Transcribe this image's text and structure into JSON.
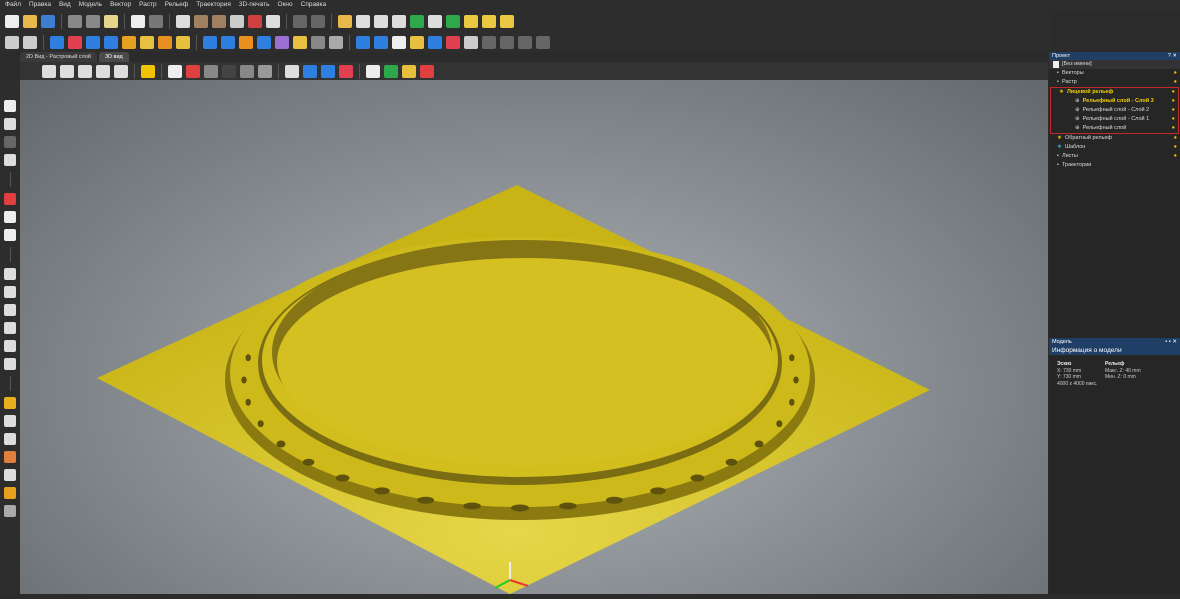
{
  "menu": [
    "Файл",
    "Правка",
    "Вид",
    "Модель",
    "Вектор",
    "Растр",
    "Рельеф",
    "Траектория",
    "3D-печать",
    "Окно",
    "Справка"
  ],
  "toolbar1": [
    {
      "icon": "new-file-icon",
      "color": "#eeeeee"
    },
    {
      "icon": "open-folder-icon",
      "color": "#e8b84a"
    },
    {
      "icon": "save-icon",
      "color": "#3c7fd0"
    },
    {
      "icon": "cut-icon",
      "color": "#888888"
    },
    {
      "icon": "copy-icon",
      "color": "#888888"
    },
    {
      "icon": "paste-icon",
      "color": "#e6d48a"
    },
    {
      "icon": "undo-icon",
      "color": "#eeeeee"
    },
    {
      "icon": "redo-icon",
      "color": "#777777"
    },
    {
      "icon": "document-icon",
      "color": "#dddddd"
    },
    {
      "icon": "model-size-icon",
      "color": "#a08060"
    },
    {
      "icon": "split-icon",
      "color": "#a08060"
    },
    {
      "icon": "grid-icon",
      "color": "#cccccc"
    },
    {
      "icon": "pin-icon",
      "color": "#d04040"
    },
    {
      "icon": "scale-icon",
      "color": "#dddddd"
    },
    {
      "icon": "shape-icon",
      "color": "#666666"
    },
    {
      "icon": "move-icon",
      "color": "#666666"
    },
    {
      "icon": "vector-import-icon",
      "color": "#e8b84a"
    },
    {
      "icon": "vector-draw-icon",
      "color": "#dddddd"
    },
    {
      "icon": "node-icon",
      "color": "#dddddd"
    },
    {
      "icon": "snowflake-icon",
      "color": "#dddddd"
    },
    {
      "icon": "relief-import-icon",
      "color": "#2ea84a"
    },
    {
      "icon": "image-icon",
      "color": "#dddddd"
    },
    {
      "icon": "layer-green-icon",
      "color": "#2ea84a"
    },
    {
      "icon": "network-icon",
      "color": "#e8c840"
    },
    {
      "icon": "wave-icon",
      "color": "#e8c840"
    },
    {
      "icon": "curve-icon",
      "color": "#e8c840"
    }
  ],
  "toolbar2": [
    {
      "icon": "zoom-icon",
      "color": "#cccccc"
    },
    {
      "icon": "settings-icon",
      "color": "#cccccc"
    },
    {
      "icon": "relief-blue-icon",
      "color": "#2f7fe0"
    },
    {
      "icon": "eraser-icon",
      "color": "#e04050"
    },
    {
      "icon": "relief-cone-icon",
      "color": "#2f7fe0"
    },
    {
      "icon": "relief-multi-icon",
      "color": "#2f7fe0"
    },
    {
      "icon": "texture-icon",
      "color": "#e8a020"
    },
    {
      "icon": "relief-bake-icon",
      "color": "#e8c040"
    },
    {
      "icon": "relief-orange-icon",
      "color": "#e89020"
    },
    {
      "icon": "relief-star-icon",
      "color": "#e8c040"
    },
    {
      "icon": "relief-flat-icon",
      "color": "#2f7fe0"
    },
    {
      "icon": "relief-sharp-icon",
      "color": "#2f7fe0"
    },
    {
      "icon": "relief-plane-icon",
      "color": "#e89020"
    },
    {
      "icon": "relief-add-icon",
      "color": "#2f7fe0"
    },
    {
      "icon": "relief-layer-icon",
      "color": "#9a70d0"
    },
    {
      "icon": "relief-smooth-icon",
      "color": "#e8c040"
    },
    {
      "icon": "relief-gray-icon",
      "color": "#888888"
    },
    {
      "icon": "arrows-icon",
      "color": "#aaaaaa"
    },
    {
      "icon": "relief-scale-icon",
      "color": "#2f7fe0"
    },
    {
      "icon": "relief-offset-icon",
      "color": "#2f7fe0"
    },
    {
      "icon": "relief-white-icon",
      "color": "#eeeeee"
    },
    {
      "icon": "layers-icon",
      "color": "#e8c040"
    },
    {
      "icon": "relief-pin-icon",
      "color": "#2f7fe0"
    },
    {
      "icon": "sphere-icon",
      "color": "#e04050"
    },
    {
      "icon": "magnet-icon",
      "color": "#cccccc"
    },
    {
      "icon": "rect-icon",
      "color": "#666666"
    },
    {
      "icon": "curve2-icon",
      "color": "#666666"
    },
    {
      "icon": "shape2-icon",
      "color": "#666666"
    },
    {
      "icon": "frame-icon",
      "color": "#666666"
    }
  ],
  "tabs": [
    "2D Вид - Растровый слой",
    "3D вид"
  ],
  "toolbar3": [
    {
      "icon": "cube-iso-icon",
      "color": "#dddddd"
    },
    {
      "icon": "cube-front-icon",
      "color": "#dddddd"
    },
    {
      "icon": "cube-side-icon",
      "color": "#dddddd"
    },
    {
      "icon": "cube-top-icon",
      "color": "#dddddd"
    },
    {
      "icon": "zoom-fit-icon",
      "color": "#dddddd"
    },
    {
      "icon": "light-icon",
      "color": "#f2c400"
    },
    {
      "icon": "plane-view-icon",
      "color": "#eeeeee"
    },
    {
      "icon": "axes-icon",
      "color": "#e04040"
    },
    {
      "icon": "grid-view-icon",
      "color": "#888888"
    },
    {
      "icon": "pointer-icon",
      "color": "#444444"
    },
    {
      "icon": "ruler-icon",
      "color": "#888888"
    },
    {
      "icon": "box-icon",
      "color": "#999999"
    },
    {
      "icon": "wire-icon",
      "color": "#dddddd"
    },
    {
      "icon": "relief-view-icon",
      "color": "#2f7fe0"
    },
    {
      "icon": "layer-view-icon",
      "color": "#2f7fe0"
    },
    {
      "icon": "red-view-icon",
      "color": "#e04050"
    },
    {
      "icon": "shade-icon",
      "color": "#eeeeee"
    },
    {
      "icon": "color-icon",
      "color": "#2ea84a"
    },
    {
      "icon": "material-icon",
      "color": "#e8c040"
    },
    {
      "icon": "palette-icon",
      "color": "#e04040"
    }
  ],
  "lefttools": [
    {
      "icon": "select-arrow-icon",
      "color": "#eeeeee"
    },
    {
      "icon": "node-edit-icon",
      "color": "#dddddd"
    },
    {
      "icon": "transform-icon",
      "color": "#666666"
    },
    {
      "icon": "grid-tool-icon",
      "color": "#dddddd"
    },
    {
      "icon": "pen-icon",
      "color": "#e04040"
    },
    {
      "icon": "eraser-tool-icon",
      "color": "#eeeeee"
    },
    {
      "icon": "fill-icon",
      "color": "#eeeeee"
    },
    {
      "icon": "polyline-icon",
      "color": "#dddddd"
    },
    {
      "icon": "rectangle-icon",
      "color": "#dddddd"
    },
    {
      "icon": "circle-icon",
      "color": "#dddddd"
    },
    {
      "icon": "polygon-icon",
      "color": "#dddddd"
    },
    {
      "icon": "arc-icon",
      "color": "#dddddd"
    },
    {
      "icon": "text-icon",
      "color": "#dddddd"
    },
    {
      "icon": "drop-icon",
      "color": "#e8b020"
    },
    {
      "icon": "brush-icon",
      "color": "#dddddd"
    },
    {
      "icon": "pencil-icon",
      "color": "#dddddd"
    },
    {
      "icon": "knife-icon",
      "color": "#e08040"
    },
    {
      "icon": "eraser2-icon",
      "color": "#dddddd"
    },
    {
      "icon": "bucket-icon",
      "color": "#e8a020"
    },
    {
      "icon": "line-icon",
      "color": "#aaaaaa"
    }
  ],
  "project": {
    "title": "Проект",
    "controls": "? ✕",
    "root": "[Без имени]",
    "items": [
      {
        "label": "Векторы",
        "level": 1,
        "icon": "vectors-icon"
      },
      {
        "label": "Растр",
        "level": 1,
        "icon": "raster-icon"
      },
      {
        "label": "Лицевой рельеф",
        "level": 1,
        "icon": "star-icon",
        "highlight": true
      },
      {
        "label": "Рельефный слой - Слой 3",
        "level": 2,
        "icon": "layer-icon",
        "highlight": true
      },
      {
        "label": "Рельефный слой - Слой 2",
        "level": 2,
        "icon": "layer-icon"
      },
      {
        "label": "Рельефный слой - Слой 1",
        "level": 2,
        "icon": "layer-icon"
      },
      {
        "label": "Рельефный слой",
        "level": 2,
        "icon": "layer-icon"
      },
      {
        "label": "Обратный рельеф",
        "level": 1,
        "icon": "star-icon"
      },
      {
        "label": "Шаблон",
        "level": 1,
        "icon": "star-blue-icon"
      },
      {
        "label": "Листы",
        "level": 1,
        "icon": "sheets-icon"
      },
      {
        "label": "Траектории",
        "level": 1,
        "icon": "toolpaths-icon"
      }
    ]
  },
  "model": {
    "title": "Модель",
    "info_title": "Информация о модели",
    "sketch_label": "Эскиз",
    "x": "X: 730 mm",
    "y": "Y: 730 mm",
    "pixels": "4000 x 4000 пикс.",
    "relief_label": "Рельеф",
    "zmax": "Макс. Z: 40 mm",
    "zmin": "Мин. Z: 0 mm"
  },
  "colors": {
    "relief": "#d8c41c",
    "accent": "#1f3f66",
    "highlight": "#c0282a"
  }
}
